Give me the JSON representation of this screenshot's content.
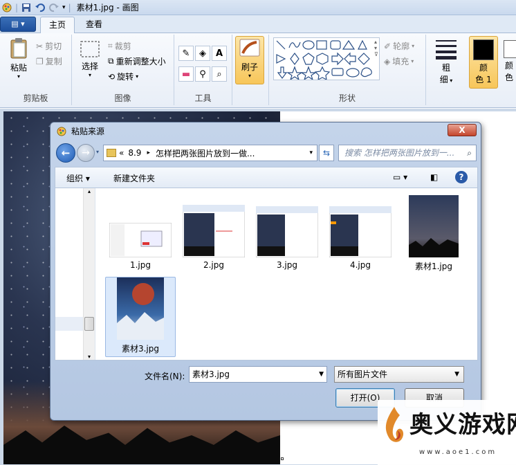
{
  "app": {
    "title": "素材1.jpg - 画图"
  },
  "tabs": {
    "file_label": "",
    "home": "主页",
    "view": "查看"
  },
  "ribbon": {
    "clipboard": {
      "paste": "粘贴",
      "cut": "剪切",
      "copy": "复制",
      "group": "剪贴板"
    },
    "image": {
      "select": "选择",
      "crop": "裁剪",
      "resize": "重新调整大小",
      "rotate": "旋转",
      "group": "图像"
    },
    "tools": {
      "group": "工具"
    },
    "brush": {
      "label": "刷子"
    },
    "shapes": {
      "outline": "轮廓",
      "fill": "填充",
      "group": "形状"
    },
    "size": {
      "label1": "粗",
      "label2": "细"
    },
    "color1": {
      "label1": "颜",
      "label2": "色 1"
    },
    "color2": {
      "label1": "颜",
      "label2": "色"
    }
  },
  "dialog": {
    "title": "粘贴来源",
    "close": "X",
    "path": {
      "prefix": "«",
      "folder": "8.9",
      "sep": "▸",
      "current": "怎样把两张图片放到一做..."
    },
    "search_placeholder": "搜索 怎样把两张图片放到一...",
    "organize": "组织 ▾",
    "new_folder": "新建文件夹",
    "files": [
      {
        "name": "1.jpg"
      },
      {
        "name": "2.jpg"
      },
      {
        "name": "3.jpg"
      },
      {
        "name": "4.jpg"
      },
      {
        "name": "素材1.jpg"
      },
      {
        "name": "素材3.jpg"
      }
    ],
    "filename_label": "文件名(N):",
    "filename_value": "素材3.jpg",
    "filetype": "所有图片文件",
    "open": "打开(O)",
    "cancel": "取消"
  },
  "watermark": {
    "brand": "奥义游戏网",
    "url": "www.aoe1.com"
  },
  "colors": {
    "accent": "#1d4f9c",
    "brush_bg": "#f7c65a",
    "close": "#c4452c"
  }
}
